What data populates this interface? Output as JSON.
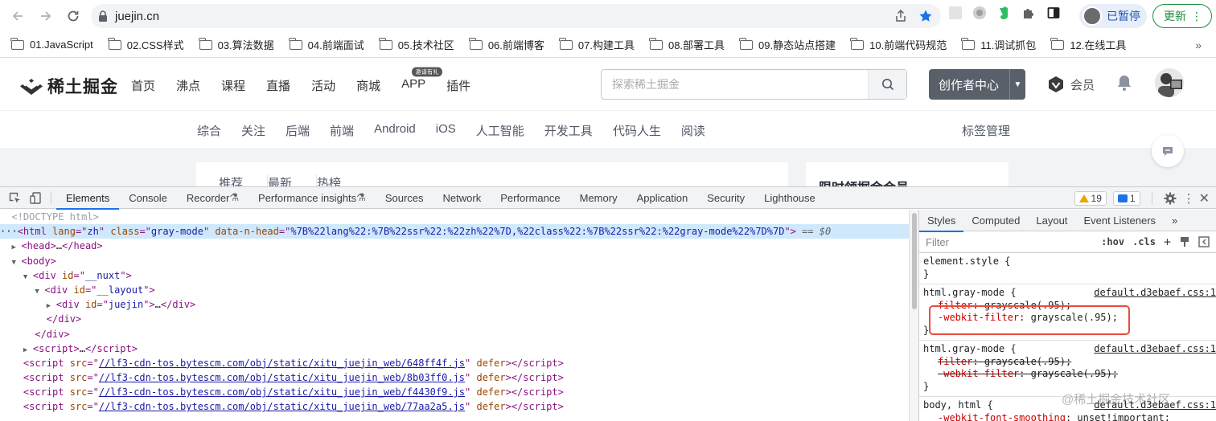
{
  "browser": {
    "url": "juejin.cn",
    "profile_label": "已暂停",
    "update_label": "更新",
    "bookmarks": [
      "01.JavaScript",
      "02.CSS样式",
      "03.算法数据",
      "04.前端面试",
      "05.技术社区",
      "06.前端博客",
      "07.构建工具",
      "08.部署工具",
      "09.静态站点搭建",
      "10.前端代码规范",
      "11.调试抓包",
      "12.在线工具"
    ],
    "bookmarks_more": "»"
  },
  "site": {
    "logo_text": "稀土掘金",
    "nav": [
      "首页",
      "沸点",
      "课程",
      "直播",
      "活动",
      "商城",
      "APP",
      "插件"
    ],
    "app_badge": "邀请有礼",
    "search_placeholder": "探索稀土掘金",
    "creator_label": "创作者中心",
    "vip_label": "会员",
    "subnav": [
      "综合",
      "关注",
      "后端",
      "前端",
      "Android",
      "iOS",
      "人工智能",
      "开发工具",
      "代码人生",
      "阅读"
    ],
    "tag_manage": "标签管理",
    "feed_tabs": [
      "推荐",
      "最新",
      "热榜"
    ],
    "side_title": "限时领掘金会员"
  },
  "devtools": {
    "tabs": [
      "Elements",
      "Console",
      "Recorder",
      "Performance insights",
      "Sources",
      "Network",
      "Performance",
      "Memory",
      "Application",
      "Security",
      "Lighthouse"
    ],
    "warnings": "19",
    "messages": "1",
    "elements": {
      "doctype": "<!DOCTYPE html>",
      "html_lang": "zh",
      "html_class": "gray-mode",
      "html_data_head": "%7B%22lang%22:%7B%22ssr%22:%22zh%22%7D,%22class%22:%7B%22ssr%22:%22gray-mode%22%7D%7D",
      "selected_marker": "== $0",
      "nuxt_id": "__nuxt",
      "layout_id": "__layout",
      "juejin_id": "juejin",
      "scripts": [
        "//lf3-cdn-tos.bytescm.com/obj/static/xitu_juejin_web/648ff4f.js",
        "//lf3-cdn-tos.bytescm.com/obj/static/xitu_juejin_web/8b03ff0.js",
        "//lf3-cdn-tos.bytescm.com/obj/static/xitu_juejin_web/f4430f9.js",
        "//lf3-cdn-tos.bytescm.com/obj/static/xitu_juejin_web/77aa2a5.js"
      ]
    },
    "styles": {
      "tabs": [
        "Styles",
        "Computed",
        "Layout",
        "Event Listeners",
        "»"
      ],
      "filter_placeholder": "Filter",
      "hov": ":hov",
      "cls": ".cls",
      "element_style": "element.style {",
      "rule1_selector": "html.gray-mode {",
      "rule1_source": "default.d3ebaef.css:1",
      "rule1_decl1_name": "filter",
      "rule1_decl1_value": "grayscale(.95);",
      "rule1_decl2_name": "-webkit-filter",
      "rule1_decl2_value": "grayscale(.95);",
      "rule2_selector": "html.gray-mode {",
      "rule2_source": "default.d3ebaef.css:1",
      "rule2_decl1_name": "filter",
      "rule2_decl1_value": "grayscale(.95);",
      "rule2_decl2_name": "-webkit-filter",
      "rule2_decl2_value": "grayscale(.95);",
      "rule3_selector": "body, html {",
      "rule3_source": "default.d3ebaef.css:1",
      "rule3_decl1_name": "-webkit-font-smoothing",
      "rule3_decl1_value": "unset!important;"
    }
  },
  "watermark": "@稀土掘金技术社区",
  "colors": {
    "accent": "#1a73e8",
    "highlight_box": "#e74c3c",
    "selected_row": "#cfe8fc"
  }
}
